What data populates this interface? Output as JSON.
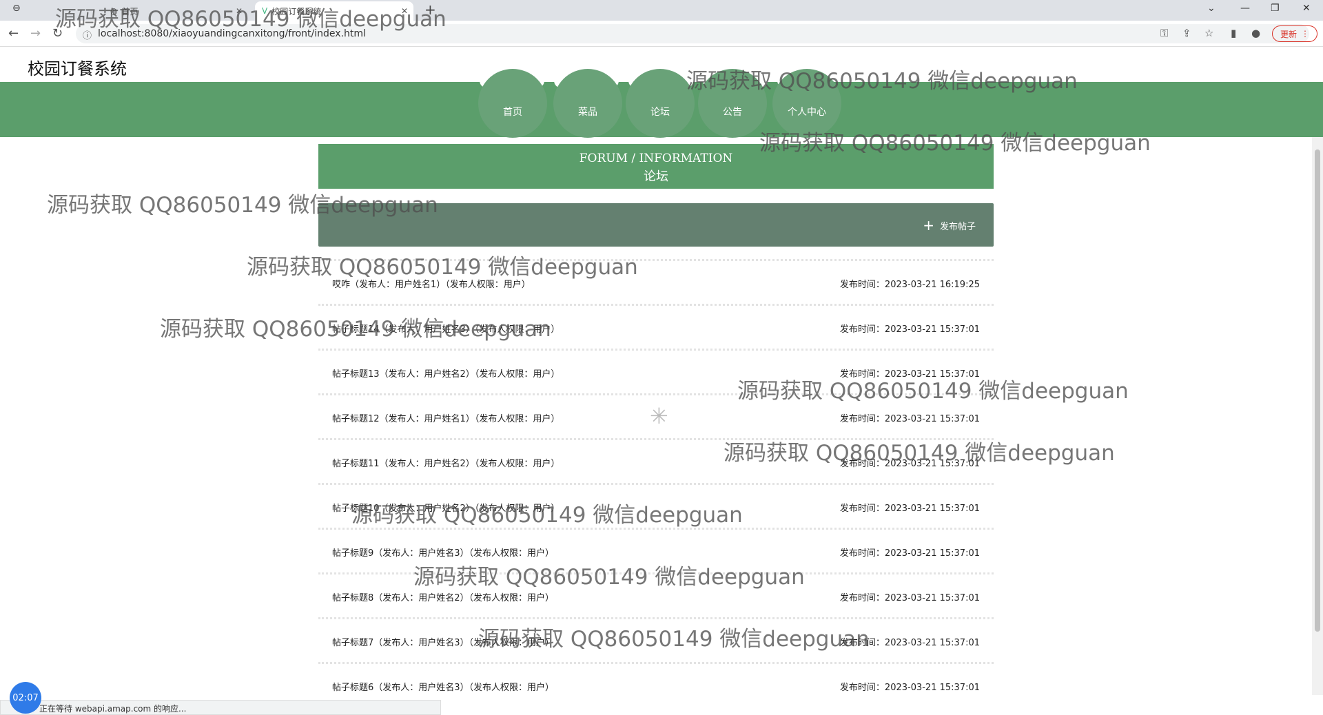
{
  "browser": {
    "tabs": [
      {
        "label": ""
      },
      {
        "label": "首页"
      },
      {
        "label": "校园订餐系统"
      }
    ],
    "new_tab": "+",
    "url": "localhost:8080/xiaoyuandingcanxitong/front/index.html",
    "update_label": "更新",
    "status_text": "正在等待 webapi.amap.com 的响应..."
  },
  "site": {
    "title": "校园订餐系统",
    "nav": [
      {
        "label": "首页"
      },
      {
        "label": "菜品"
      },
      {
        "label": "论坛"
      },
      {
        "label": "公告"
      },
      {
        "label": "个人中心"
      }
    ]
  },
  "forum": {
    "heading_en": "FORUM / INFORMATION",
    "heading_cn": "论坛",
    "post_button": "发布帖子",
    "posts": [
      {
        "title": "哎咋（发布人：用户姓名1）（发布人权限：用户）",
        "time": "发布时间：2023-03-21 16:19:25"
      },
      {
        "title": "帖子标题14（发布人：用户姓名3）（发布人权限：用户）",
        "time": "发布时间：2023-03-21 15:37:01"
      },
      {
        "title": "帖子标题13（发布人：用户姓名2）（发布人权限：用户）",
        "time": "发布时间：2023-03-21 15:37:01"
      },
      {
        "title": "帖子标题12（发布人：用户姓名1）（发布人权限：用户）",
        "time": "发布时间：2023-03-21 15:37:01"
      },
      {
        "title": "帖子标题11（发布人：用户姓名2）（发布人权限：用户）",
        "time": "发布时间：2023-03-21 15:37:01"
      },
      {
        "title": "帖子标题10（发布人：用户姓名2）（发布人权限：用户）",
        "time": "发布时间：2023-03-21 15:37:01"
      },
      {
        "title": "帖子标题9（发布人：用户姓名3）（发布人权限：用户）",
        "time": "发布时间：2023-03-21 15:37:01"
      },
      {
        "title": "帖子标题8（发布人：用户姓名2）（发布人权限：用户）",
        "time": "发布时间：2023-03-21 15:37:01"
      },
      {
        "title": "帖子标题7（发布人：用户姓名3）（发布人权限：用户）",
        "time": "发布时间：2023-03-21 15:37:01"
      },
      {
        "title": "帖子标题6（发布人：用户姓名3）（发布人权限：用户）",
        "time": "发布时间：2023-03-21 15:37:01"
      }
    ]
  },
  "timer": "02:07",
  "watermark": "源码获取 QQ86050149 微信deepguan",
  "colors": {
    "nav_green": "#5b9e6b",
    "post_bar": "#648070",
    "accent_blue": "#2f7be8"
  }
}
